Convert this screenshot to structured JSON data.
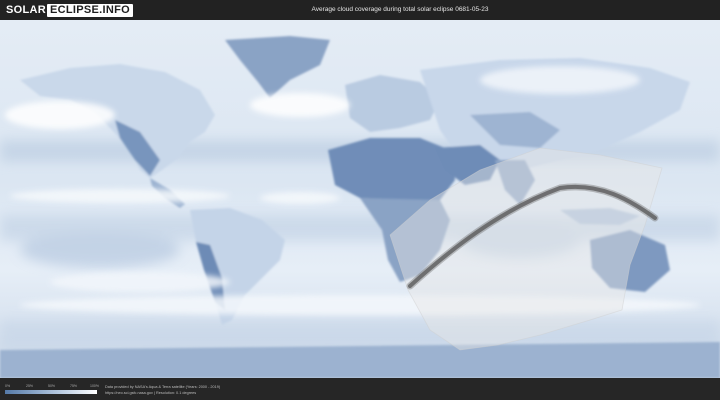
{
  "header": {
    "logo_solar": "SOLAR",
    "logo_eclipse": "ECLIPSE.INFO",
    "title": "Average cloud coverage during total solar eclipse 0681-05-23"
  },
  "map": {
    "type": "world-cloud-coverage",
    "colors": {
      "ocean_cloud": "#e8eff7",
      "clear_land": "#6e8db8",
      "eclipse_band": "#e6e6e6",
      "totality_path": "#555555",
      "cloud_white": "#ffffff"
    }
  },
  "footer": {
    "legend": {
      "ticks": [
        "0%",
        "25%",
        "50%",
        "75%",
        "100%"
      ]
    },
    "credits_line1": "Data provided by NASA's Aqua & Terra satellite (Years: 2000 - 2019)",
    "credits_line2": "https://neo.sci.gsfc.nasa.gov | Resolution: 0.1 degrees"
  }
}
